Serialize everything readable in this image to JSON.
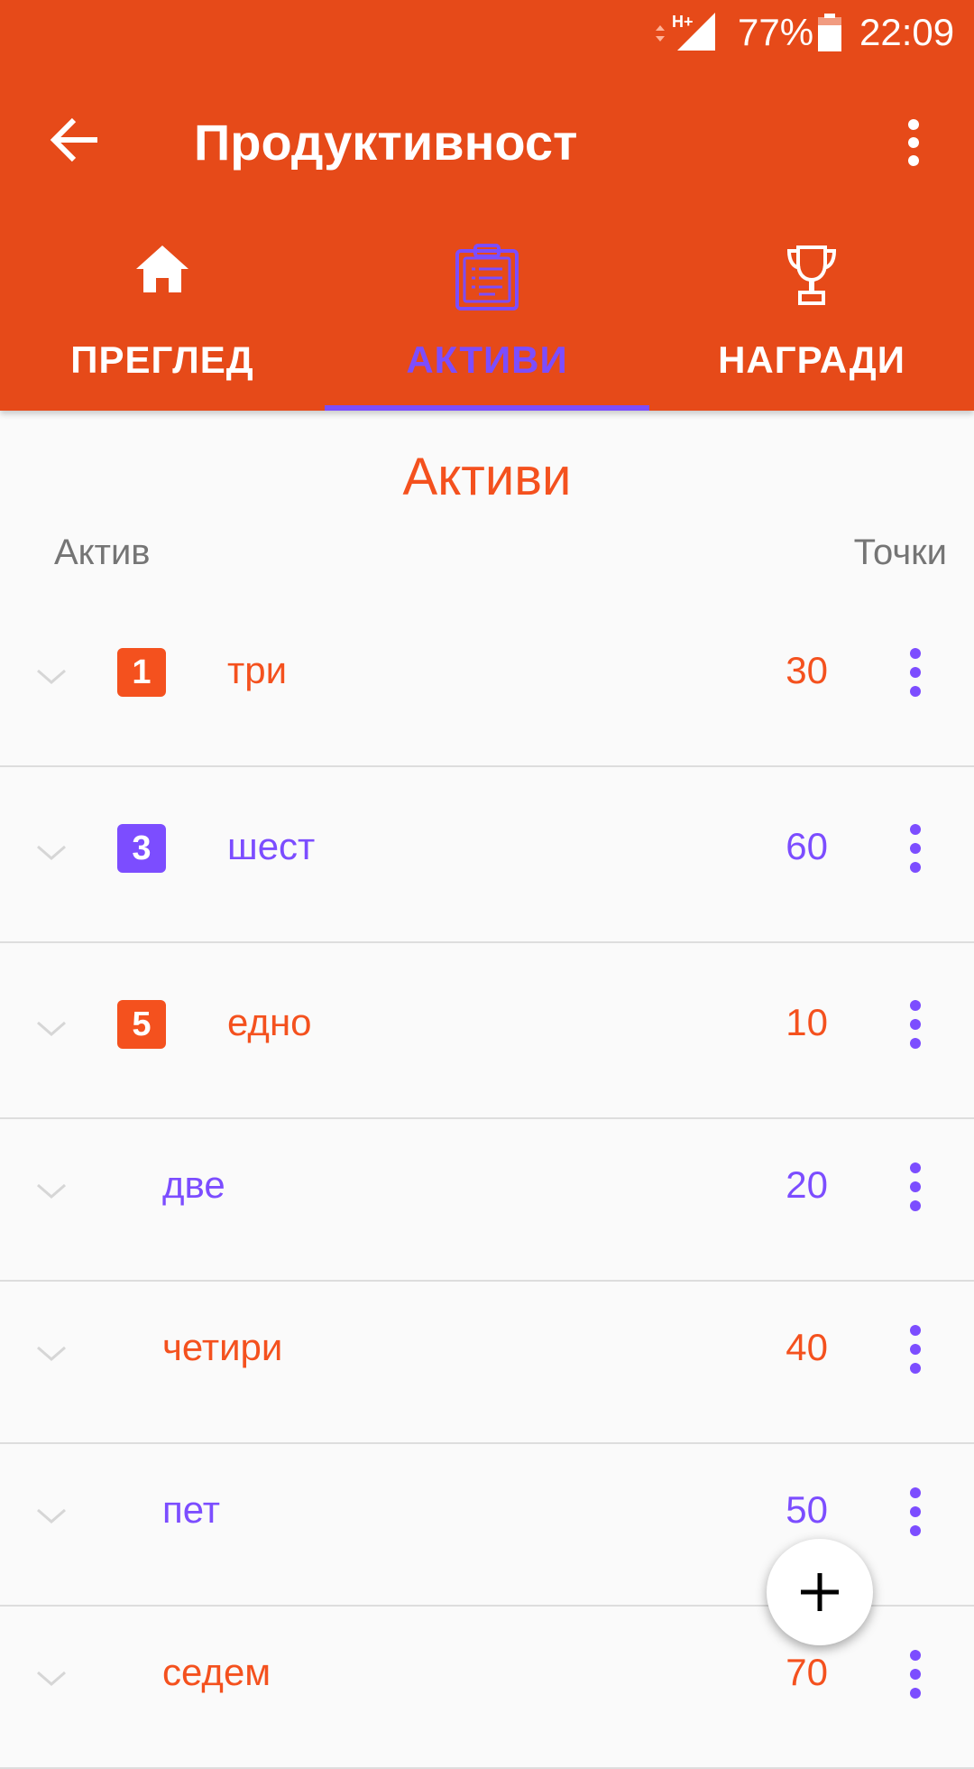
{
  "status_bar": {
    "network_label": "H+",
    "battery_percent": "77%",
    "time": "22:09"
  },
  "app_bar": {
    "title": "Продуктивност",
    "back_icon": "arrow-back-icon",
    "menu_icon": "more-vert-icon"
  },
  "tabs": [
    {
      "label": "ПРЕГЛЕД",
      "icon": "home-icon",
      "active": false
    },
    {
      "label": "АКТИВИ",
      "icon": "clipboard-list-icon",
      "active": true
    },
    {
      "label": "НАГРАДИ",
      "icon": "trophy-icon",
      "active": false
    }
  ],
  "section": {
    "title": "Активи",
    "col_asset": "Актив",
    "col_points": "Точки"
  },
  "rows": [
    {
      "name": "три",
      "points": "30",
      "badge": "1",
      "color": "#F4511E"
    },
    {
      "name": "шест",
      "points": "60",
      "badge": "3",
      "color": "#7C4DFF"
    },
    {
      "name": "едно",
      "points": "10",
      "badge": "5",
      "color": "#F4511E"
    },
    {
      "name": "две",
      "points": "20",
      "badge": "",
      "color": "#7C4DFF"
    },
    {
      "name": "четири",
      "points": "40",
      "badge": "",
      "color": "#F4511E"
    },
    {
      "name": "пет",
      "points": "50",
      "badge": "",
      "color": "#7C4DFF"
    },
    {
      "name": "седем",
      "points": "70",
      "badge": "",
      "color": "#F4511E"
    }
  ],
  "fab": {
    "icon": "plus-icon"
  },
  "colors": {
    "primary": "#E64A19",
    "accent": "#7C4DFF",
    "orange_text": "#F4511E"
  }
}
